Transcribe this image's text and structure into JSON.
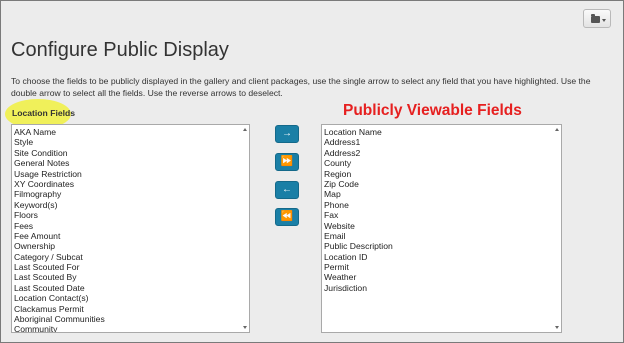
{
  "page": {
    "title": "Configure Public Display",
    "description": "To choose the fields to be publicly displayed in the gallery and client packages, use the single arrow to select any field that you have highlighted. Use the double arrow to select all the fields. Use the reverse arrows to deselect."
  },
  "toolbar": {
    "folder_icon": "folder-icon",
    "caret_icon": "caret-down-icon"
  },
  "left_list": {
    "label": "Location Fields",
    "items": [
      "AKA Name",
      "Style",
      "Site Condition",
      "General Notes",
      "Usage Restriction",
      "XY Coordinates",
      "Filmography",
      "Keyword(s)",
      "Floors",
      "Fees",
      "Fee Amount",
      "Ownership",
      "Category / Subcat",
      "Last Scouted For",
      "Last Scouted By",
      "Last Scouted Date",
      "Location Contact(s)",
      "Clackamus Permit",
      "Aboriginal Communities",
      "Community"
    ]
  },
  "right_list": {
    "label": "Publicly Viewable Fields",
    "items": [
      "Location Name",
      "Address1",
      "Address2",
      "County",
      "Region",
      "Zip Code",
      "Map",
      "Phone",
      "Fax",
      "Website",
      "Email",
      "Public Description",
      "Location ID",
      "Permit",
      "Weather",
      "Jurisdiction"
    ]
  },
  "buttons": {
    "add_selected": "→",
    "add_all": "⏩",
    "remove_selected": "←",
    "remove_all": "⏪"
  },
  "colors": {
    "accent_button": "#1a7fa6",
    "highlight": "#f0f046",
    "red_title": "#e62020"
  }
}
